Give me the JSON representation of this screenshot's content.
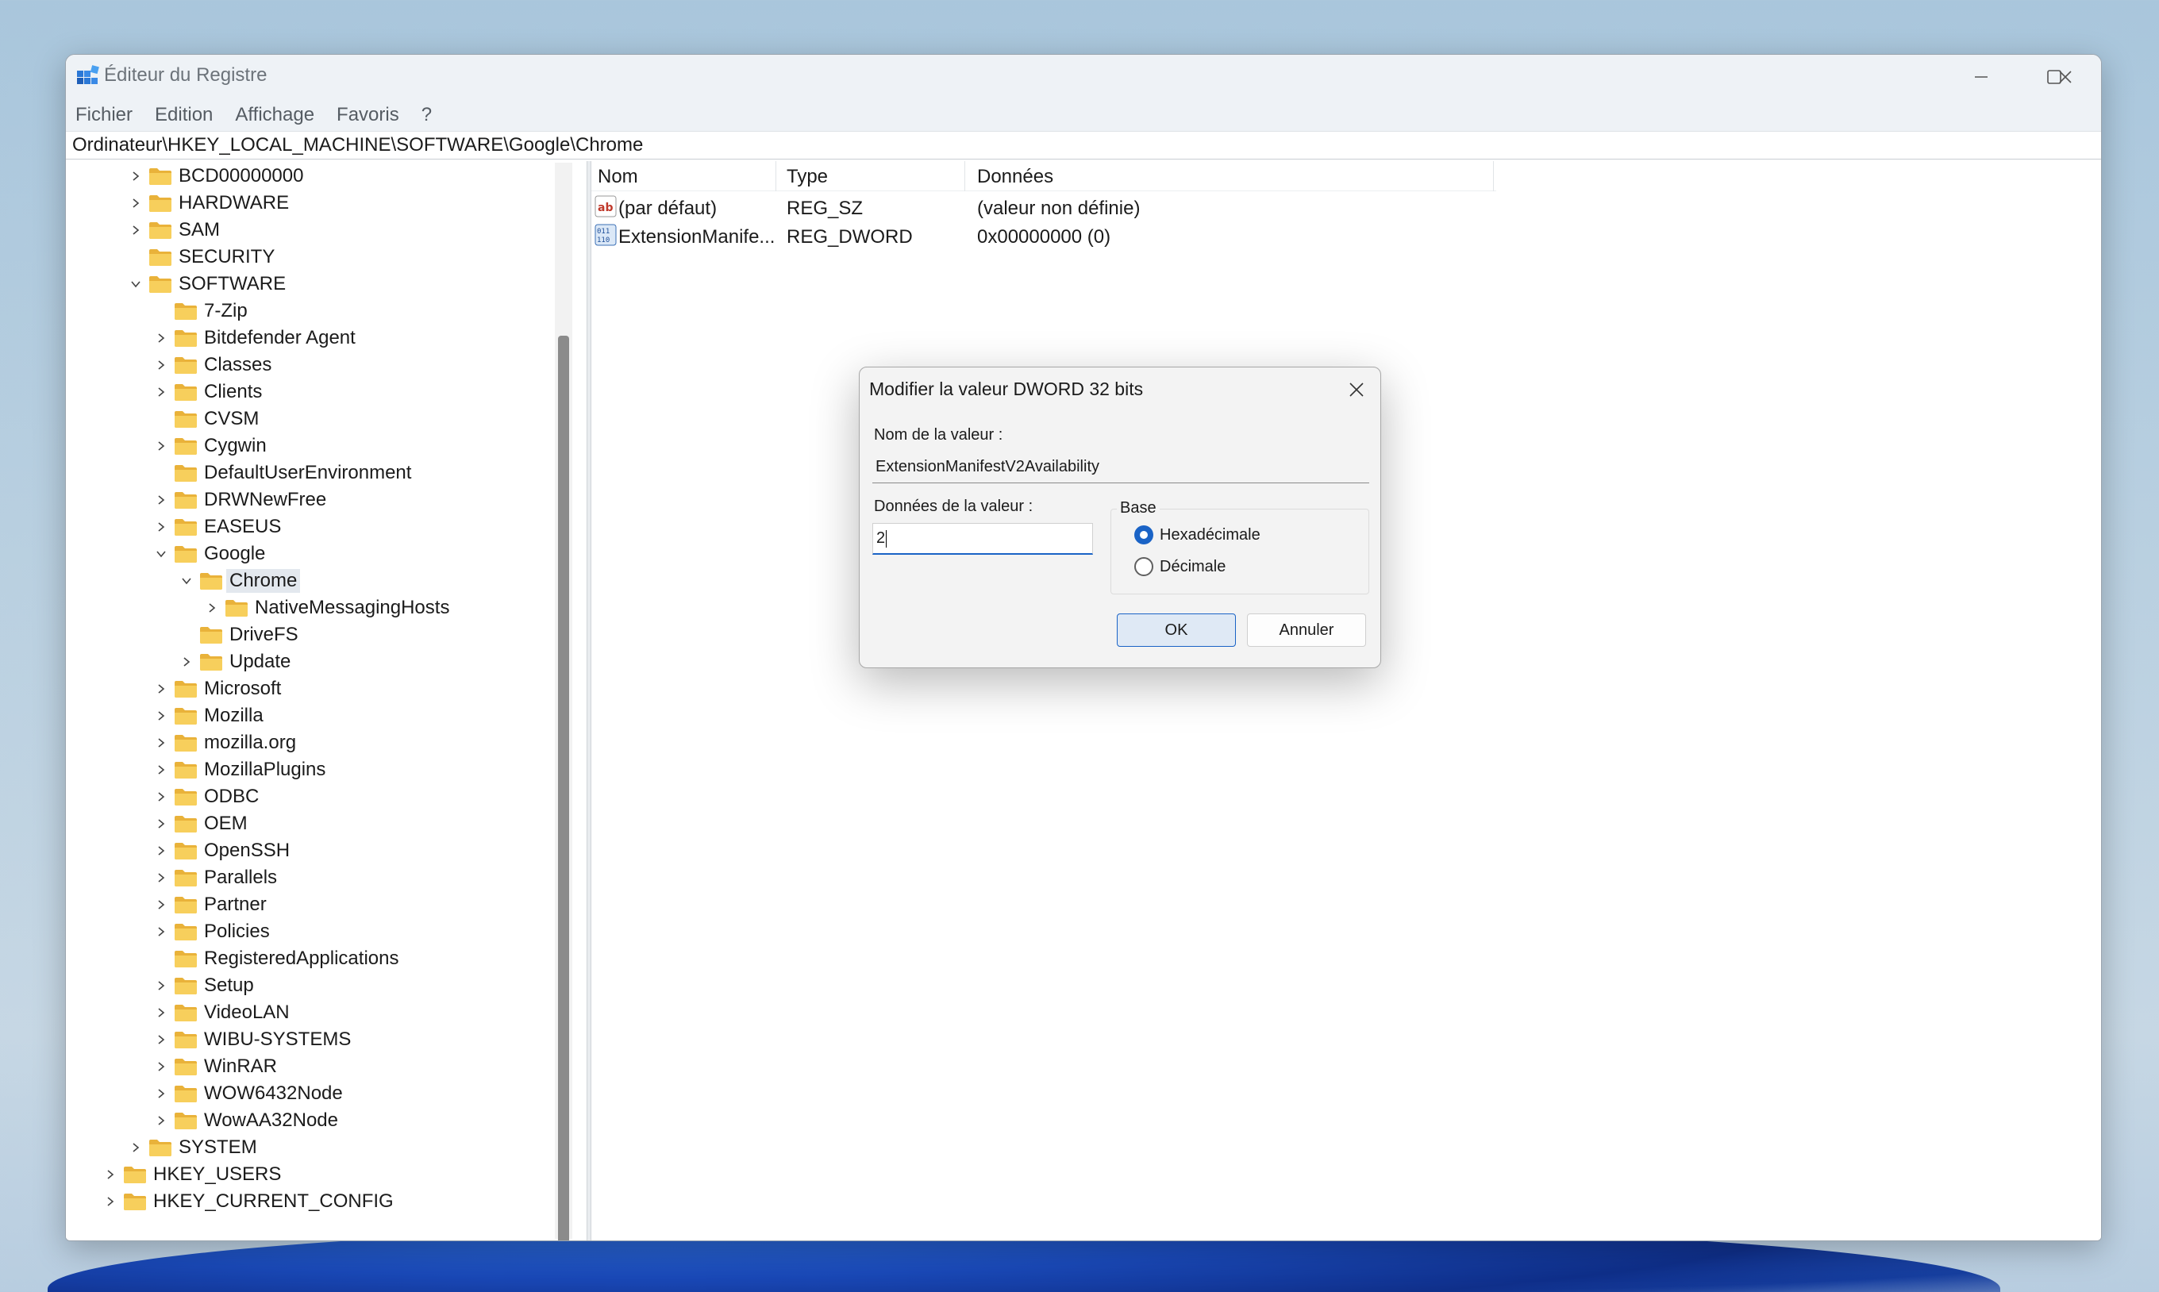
{
  "window": {
    "title": "Éditeur du Registre"
  },
  "menu": [
    "Fichier",
    "Edition",
    "Affichage",
    "Favoris",
    "?"
  ],
  "address": "Ordinateur\\HKEY_LOCAL_MACHINE\\SOFTWARE\\Google\\Chrome",
  "tree": [
    {
      "label": "BCD00000000",
      "level": 2,
      "expandable": true
    },
    {
      "label": "HARDWARE",
      "level": 2,
      "expandable": true
    },
    {
      "label": "SAM",
      "level": 2,
      "expandable": true
    },
    {
      "label": "SECURITY",
      "level": 2,
      "expandable": false
    },
    {
      "label": "SOFTWARE",
      "level": 2,
      "expandable": true,
      "expanded": true
    },
    {
      "label": "7-Zip",
      "level": 3,
      "expandable": false
    },
    {
      "label": "Bitdefender Agent",
      "level": 3,
      "expandable": true
    },
    {
      "label": "Classes",
      "level": 3,
      "expandable": true
    },
    {
      "label": "Clients",
      "level": 3,
      "expandable": true
    },
    {
      "label": "CVSM",
      "level": 3,
      "expandable": false
    },
    {
      "label": "Cygwin",
      "level": 3,
      "expandable": true
    },
    {
      "label": "DefaultUserEnvironment",
      "level": 3,
      "expandable": false
    },
    {
      "label": "DRWNewFree",
      "level": 3,
      "expandable": true
    },
    {
      "label": "EASEUS",
      "level": 3,
      "expandable": true
    },
    {
      "label": "Google",
      "level": 3,
      "expandable": true,
      "expanded": true
    },
    {
      "label": "Chrome",
      "level": 4,
      "expandable": true,
      "expanded": true,
      "selected": true
    },
    {
      "label": "NativeMessagingHosts",
      "level": 5,
      "expandable": true
    },
    {
      "label": "DriveFS",
      "level": 4,
      "expandable": false
    },
    {
      "label": "Update",
      "level": 4,
      "expandable": true
    },
    {
      "label": "Microsoft",
      "level": 3,
      "expandable": true
    },
    {
      "label": "Mozilla",
      "level": 3,
      "expandable": true
    },
    {
      "label": "mozilla.org",
      "level": 3,
      "expandable": true
    },
    {
      "label": "MozillaPlugins",
      "level": 3,
      "expandable": true
    },
    {
      "label": "ODBC",
      "level": 3,
      "expandable": true
    },
    {
      "label": "OEM",
      "level": 3,
      "expandable": true
    },
    {
      "label": "OpenSSH",
      "level": 3,
      "expandable": true
    },
    {
      "label": "Parallels",
      "level": 3,
      "expandable": true
    },
    {
      "label": "Partner",
      "level": 3,
      "expandable": true
    },
    {
      "label": "Policies",
      "level": 3,
      "expandable": true
    },
    {
      "label": "RegisteredApplications",
      "level": 3,
      "expandable": false
    },
    {
      "label": "Setup",
      "level": 3,
      "expandable": true
    },
    {
      "label": "VideoLAN",
      "level": 3,
      "expandable": true
    },
    {
      "label": "WIBU-SYSTEMS",
      "level": 3,
      "expandable": true
    },
    {
      "label": "WinRAR",
      "level": 3,
      "expandable": true
    },
    {
      "label": "WOW6432Node",
      "level": 3,
      "expandable": true
    },
    {
      "label": "WowAA32Node",
      "level": 3,
      "expandable": true
    },
    {
      "label": "SYSTEM",
      "level": 2,
      "expandable": true
    },
    {
      "label": "HKEY_USERS",
      "level": 1,
      "expandable": true
    },
    {
      "label": "HKEY_CURRENT_CONFIG",
      "level": 1,
      "expandable": true
    }
  ],
  "list": {
    "headers": {
      "name": "Nom",
      "type": "Type",
      "data": "Données"
    },
    "rows": [
      {
        "name": "(par défaut)",
        "type": "REG_SZ",
        "data": "(valeur non définie)",
        "icon": "string-value-icon"
      },
      {
        "name": "ExtensionManife...",
        "type": "REG_DWORD",
        "data": "0x00000000 (0)",
        "icon": "binary-value-icon"
      }
    ]
  },
  "dialog": {
    "title": "Modifier la valeur DWORD 32 bits",
    "name_label": "Nom de la valeur :",
    "name_value": "ExtensionManifestV2Availability",
    "data_label": "Données de la valeur :",
    "data_value": "2",
    "base_label": "Base",
    "base_options": [
      "Hexadécimale",
      "Décimale"
    ],
    "base_selected": "Hexadécimale",
    "ok_label": "OK",
    "cancel_label": "Annuler"
  },
  "colors": {
    "accent": "#1a63c6",
    "folder": "#f2c14e",
    "selection": "#e3e8ee"
  }
}
